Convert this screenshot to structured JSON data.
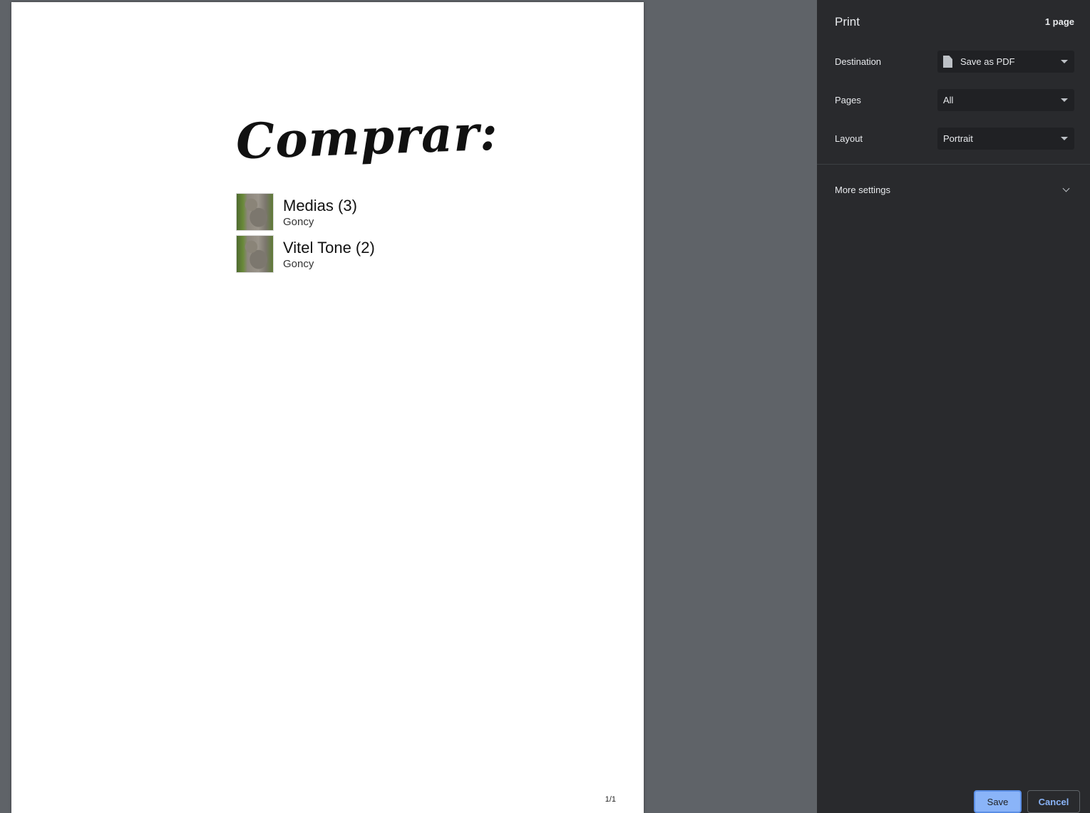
{
  "preview": {
    "document_title": "Comprar:",
    "items": [
      {
        "name": "Medias (3)",
        "subtitle": "Goncy"
      },
      {
        "name": "Vitel Tone (2)",
        "subtitle": "Goncy"
      }
    ],
    "page_number": "1/1"
  },
  "panel": {
    "title": "Print",
    "page_count": "1 page",
    "destination": {
      "label": "Destination",
      "value": "Save as PDF",
      "icon": "file-icon"
    },
    "pages": {
      "label": "Pages",
      "value": "All"
    },
    "layout": {
      "label": "Layout",
      "value": "Portrait"
    },
    "more_settings": "More settings",
    "save_label": "Save",
    "cancel_label": "Cancel"
  },
  "colors": {
    "panel_bg": "#292a2d",
    "preview_bg": "#5f6368",
    "accent": "#8ab4f8"
  }
}
